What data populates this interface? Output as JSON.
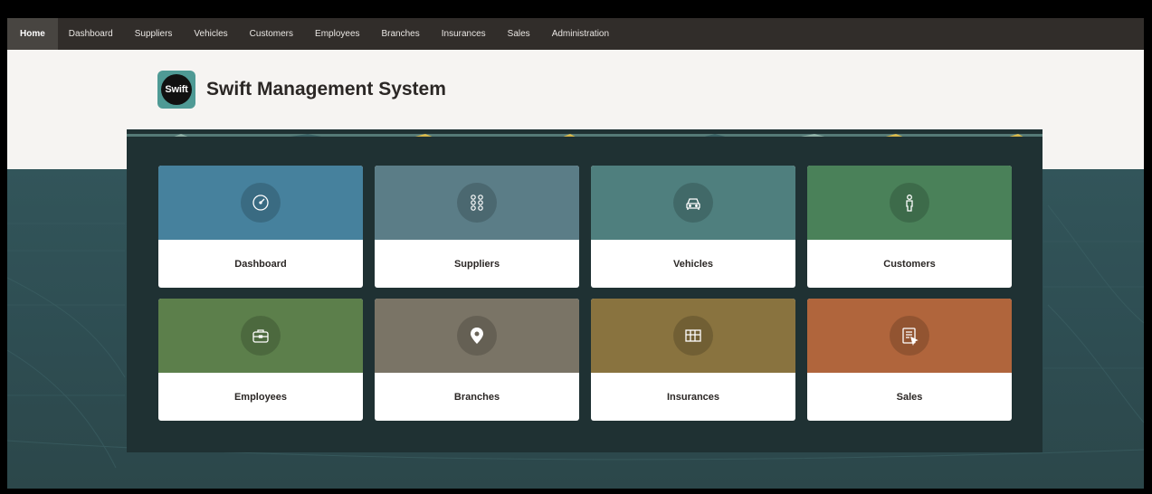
{
  "nav": {
    "items": [
      {
        "label": "Home",
        "active": true
      },
      {
        "label": "Dashboard"
      },
      {
        "label": "Suppliers"
      },
      {
        "label": "Vehicles"
      },
      {
        "label": "Customers"
      },
      {
        "label": "Employees"
      },
      {
        "label": "Branches"
      },
      {
        "label": "Insurances"
      },
      {
        "label": "Sales"
      },
      {
        "label": "Administration"
      }
    ]
  },
  "header": {
    "logo_text": "Swift",
    "title": "Swift Management System"
  },
  "cards": [
    {
      "label": "Dashboard",
      "color": "#46819d",
      "icon": "gauge-icon"
    },
    {
      "label": "Suppliers",
      "color": "#5b7d87",
      "icon": "grid-dots-icon"
    },
    {
      "label": "Vehicles",
      "color": "#4f7f7e",
      "icon": "car-icon"
    },
    {
      "label": "Customers",
      "color": "#4a8159",
      "icon": "person-icon"
    },
    {
      "label": "Employees",
      "color": "#5c7f4b",
      "icon": "briefcase-icon"
    },
    {
      "label": "Branches",
      "color": "#7a7466",
      "icon": "map-pin-icon"
    },
    {
      "label": "Insurances",
      "color": "#89733f",
      "icon": "table-icon"
    },
    {
      "label": "Sales",
      "color": "#b0653c",
      "icon": "form-cursor-icon"
    }
  ]
}
